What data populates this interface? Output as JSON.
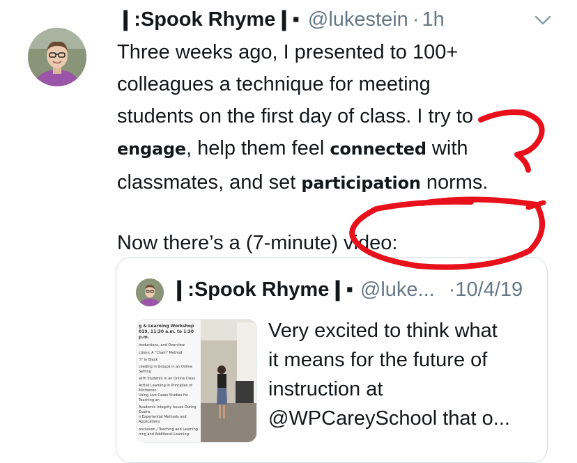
{
  "tweet": {
    "display_name": "❙:Spook Rhyme❙▪",
    "handle": "@lukestein",
    "dot": "·",
    "time": "1h",
    "menu_icon": "chevron-down-icon",
    "lines": [
      "Three weeks ago, I presented to 100+",
      "colleagues a technique for meeting",
      "students on the first day of class. I try to"
    ],
    "line4_bold1": "engage",
    "line4_rest": ", help them feel ",
    "line4_bold2": "connected",
    "line4_end": " with",
    "line5_start": "classmates, and set ",
    "line5_bold": "participation",
    "line5_end": " norms.",
    "line6": "Now there’s a (7-minute) video:"
  },
  "quoted": {
    "display_name": "❙:Spook Rhyme❙▪",
    "handle": "@luke...",
    "date": "·10/4/19",
    "text_lines": [
      "Very excited to think what",
      "it means for the future of",
      "instruction at",
      "@WPCareySchool that o..."
    ],
    "slide_title": "g & Learning Workshop",
    "slide_subtitle": "019, 11:30 a.m. to 1:30 p.m.",
    "slide_lines": [
      "troductions, and Overview",
      "ctions: A \"Chain\" Method",
      "\"I\" in Black",
      "ceeding in Groups in an Online Setting",
      "with Students in an Online Class",
      "Active Learning in Principles of Microecon",
      "Using Live Cases Studies for Teaching an",
      "Academic Integrity Issues During Exams",
      "n Experiential Methods and Applications",
      "onclusion / Teaching and Learning",
      "ning and Additional Learning"
    ]
  },
  "colors": {
    "text": "#14171a",
    "secondary": "#657786",
    "border": "#d5dde3",
    "annotation_red": "#e8101a"
  }
}
